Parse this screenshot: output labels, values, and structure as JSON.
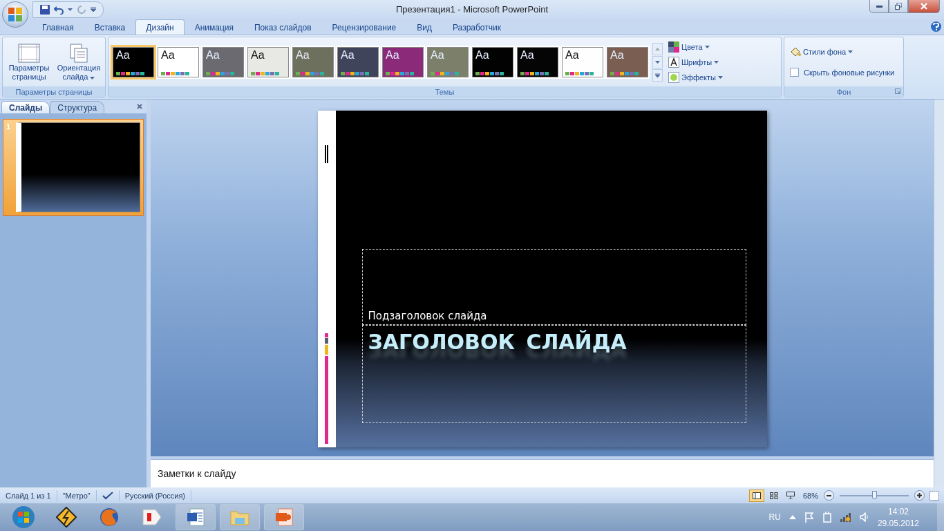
{
  "window": {
    "title": "Презентация1 - Microsoft PowerPoint"
  },
  "tabs": [
    {
      "label": "Главная",
      "selected": false
    },
    {
      "label": "Вставка",
      "selected": false
    },
    {
      "label": "Дизайн",
      "selected": true
    },
    {
      "label": "Анимация",
      "selected": false
    },
    {
      "label": "Показ слайдов",
      "selected": false
    },
    {
      "label": "Рецензирование",
      "selected": false
    },
    {
      "label": "Вид",
      "selected": false
    },
    {
      "label": "Разработчик",
      "selected": false
    }
  ],
  "page_setup": {
    "buttons": [
      {
        "label": "Параметры страницы",
        "dropdown": false
      },
      {
        "label": "Ориентация слайда",
        "dropdown": true
      }
    ],
    "group_label": "Параметры страницы"
  },
  "themes": {
    "items": [
      {
        "label": "Aa",
        "color": "#000000",
        "selected": true
      },
      {
        "label": "Aa",
        "color": "#ffffff",
        "selected": false
      },
      {
        "label": "Aa",
        "color": "#6a6a70",
        "selected": false
      },
      {
        "label": "Aa",
        "color": "#e8e8e4",
        "selected": false
      },
      {
        "label": "Aa",
        "color": "#6e705e",
        "selected": false
      },
      {
        "label": "Aa",
        "color": "#40445a",
        "selected": false
      },
      {
        "label": "Aa",
        "color": "#8a2a78",
        "selected": false
      },
      {
        "label": "Aa",
        "color": "#7c806a",
        "selected": false
      },
      {
        "label": "Aa",
        "color": "#020202",
        "selected": false
      },
      {
        "label": "Aa",
        "color": "#050505",
        "selected": false
      },
      {
        "label": "Aa",
        "color": "#fefefe",
        "selected": false
      },
      {
        "label": "Aa",
        "color": "#7a5e52",
        "selected": false
      }
    ],
    "options": [
      {
        "kind": "colors",
        "label": "Цвета"
      },
      {
        "kind": "fonts",
        "label": "Шрифты"
      },
      {
        "kind": "effects",
        "label": "Эффекты"
      }
    ],
    "group_label": "Темы"
  },
  "background": {
    "styles_label": "Стили фона",
    "hide_graphics": {
      "label": "Скрыть фоновые рисунки",
      "checked": false
    },
    "group_label": "Фон"
  },
  "pane_tabs": [
    {
      "label": "Слайды",
      "selected": true
    },
    {
      "label": "Структура",
      "selected": false
    }
  ],
  "slides": [
    {
      "number": "1",
      "selected": true
    }
  ],
  "slide": {
    "subtitle": "Подзаголовок слайда",
    "title": "ЗАГОЛОВОК СЛАЙДА"
  },
  "notes": {
    "text": "Заметки к слайду"
  },
  "status_bar": {
    "items": [
      "Слайд 1 из 1",
      "\"Метро\"",
      "Русский (Россия)"
    ],
    "zoom": "68%",
    "zoom_slider": {
      "level": 0.5
    }
  },
  "taskbar": {
    "language": "RU",
    "time": "14:02",
    "date": "29.05.2012"
  }
}
